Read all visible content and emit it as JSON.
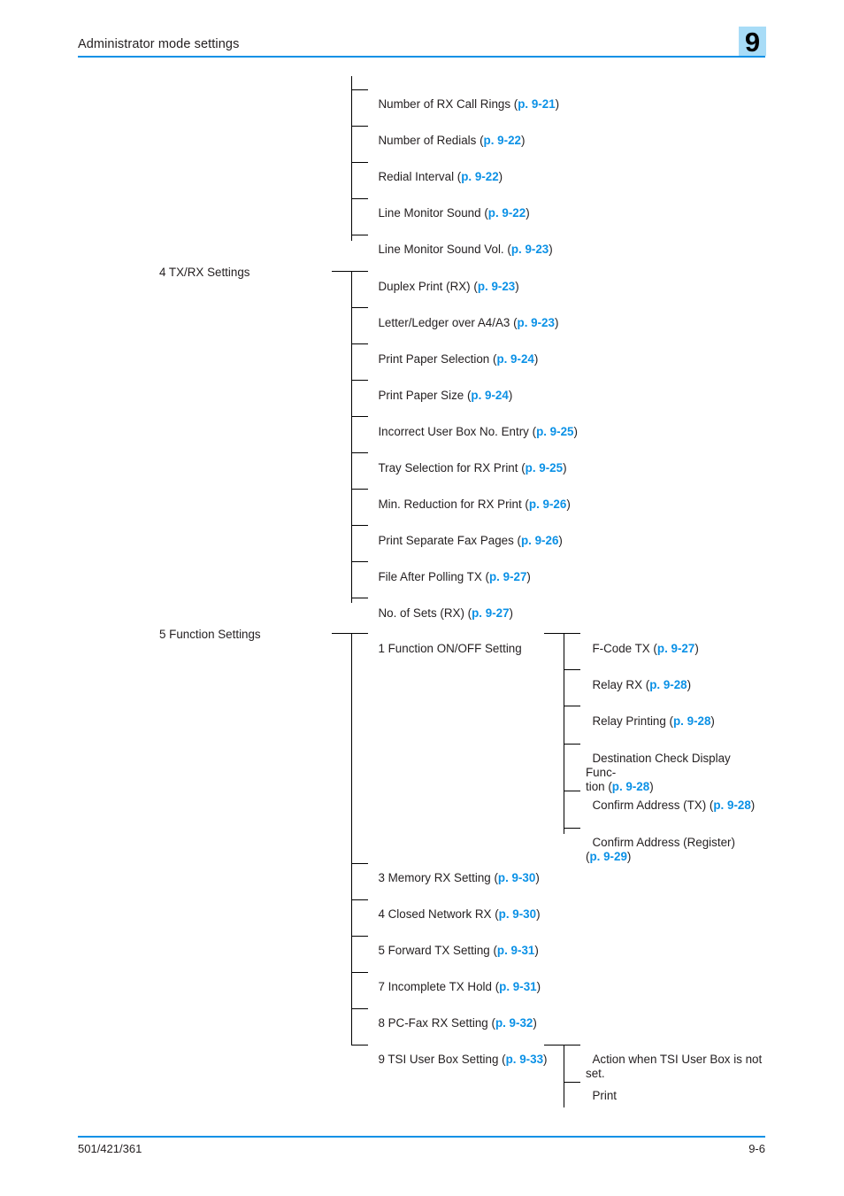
{
  "page": {
    "header_title": "Administrator mode settings",
    "chapter_number": "9",
    "footer_left": "501/421/361",
    "footer_right": "9-6",
    "accent_color": "#0b91e6",
    "badge_color": "#a8dcf7",
    "text_color": "#231f20"
  },
  "tree": {
    "group_rx_settings": {
      "items": [
        {
          "label": "Number of RX Call Rings",
          "ref": "p. 9-21"
        },
        {
          "label": "Number of Redials",
          "ref": "p. 9-22"
        },
        {
          "label": "Redial Interval",
          "ref": "p. 9-22"
        },
        {
          "label": "Line Monitor Sound",
          "ref": "p. 9-22"
        },
        {
          "label": "Line Monitor Sound Vol.",
          "ref": "p. 9-23"
        }
      ]
    },
    "group_txrx": {
      "parent_label": "4 TX/RX Settings",
      "items": [
        {
          "label": "Duplex Print (RX)",
          "ref": "p. 9-23"
        },
        {
          "label": "Letter/Ledger over A4/A3",
          "ref": "p. 9-23"
        },
        {
          "label": "Print Paper Selection",
          "ref": "p. 9-24"
        },
        {
          "label": "Print Paper Size",
          "ref": "p. 9-24"
        },
        {
          "label": "Incorrect User Box No. Entry",
          "ref": "p. 9-25"
        },
        {
          "label": "Tray Selection for RX Print",
          "ref": "p. 9-25"
        },
        {
          "label": "Min. Reduction for RX Print",
          "ref": "p. 9-26"
        },
        {
          "label": "Print Separate Fax Pages",
          "ref": "p. 9-26"
        },
        {
          "label": "File After Polling TX",
          "ref": "p. 9-27"
        },
        {
          "label": "No. of Sets (RX)",
          "ref": "p. 9-27"
        }
      ]
    },
    "group_function": {
      "parent_label": "5 Function Settings",
      "items": [
        {
          "label": "1 Function ON/OFF Setting",
          "ref": ""
        },
        {
          "label": "3 Memory RX Setting",
          "ref": "p. 9-30"
        },
        {
          "label": "4 Closed Network RX",
          "ref": "p. 9-30"
        },
        {
          "label": "5 Forward TX Setting",
          "ref": "p. 9-31"
        },
        {
          "label": "7 Incomplete TX Hold",
          "ref": "p. 9-31"
        },
        {
          "label": "8 PC-Fax RX Setting",
          "ref": "p. 9-32"
        },
        {
          "label": "9 TSI User Box Setting",
          "ref": "p. 9-33"
        }
      ]
    },
    "group_function_onoff": {
      "items": [
        {
          "label": "F-Code TX",
          "ref": "p. 9-27"
        },
        {
          "label": "Relay RX",
          "ref": "p. 9-28"
        },
        {
          "label": "Relay Printing",
          "ref": "p. 9-28"
        },
        {
          "label": "Destination Check Display Func-\ntion",
          "ref": "p. 9-28"
        },
        {
          "label": "Confirm Address (TX)",
          "ref": "p. 9-28"
        },
        {
          "label": "Confirm Address (Register)\n",
          "ref": "p. 9-29"
        }
      ]
    },
    "group_tsi": {
      "items": [
        {
          "label": "Action when TSI User Box is not\nset.",
          "ref": ""
        },
        {
          "label": "Print",
          "ref": ""
        }
      ]
    }
  }
}
